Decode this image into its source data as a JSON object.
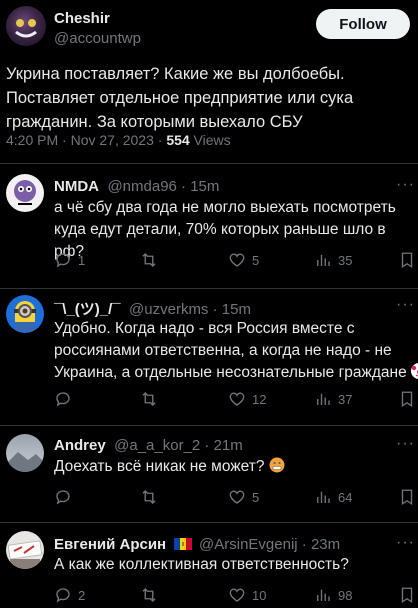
{
  "main_tweet": {
    "author_name": "Cheshir",
    "author_handle": "@accountwp",
    "follow_label": "Follow",
    "text_lines": [
      "Укрина поставляет? Какие же вы долбоебы.",
      "Поставляет отдельное предприятие или сука",
      "гражданин. За которыми выехало СБУ"
    ],
    "meta_time": "4:20 PM · Nov 27, 2023 · ",
    "views_count": "554",
    "views_label": " Views"
  },
  "replies": [
    {
      "name": "NMDA",
      "handle": "@nmda96 · 15m",
      "text_lines": [
        "а чё сбу два года не могло выехать посмотреть",
        "куда едут детали, 70% которых раньше шло в рф?"
      ],
      "reply_count": "1",
      "retweet_count": "",
      "like_count": "5",
      "view_count": "35"
    },
    {
      "name": "¯\\_(ツ)_/¯",
      "handle": "@uzverkms · 15m",
      "text_lines": [
        "Удобно. Когда надо - вся Россия вместе с",
        "россиянами ответственна, а когда не надо - не",
        "Украина, а отдельные несознательные граждане"
      ],
      "emoji": "clown-face-icon",
      "reply_count": "",
      "retweet_count": "",
      "like_count": "12",
      "view_count": "37"
    },
    {
      "name": "Andrey",
      "handle": "@a_a_kor_2 · 21m",
      "text_lines": [
        "Доехать всё никак не может?"
      ],
      "emoji": "grimacing-face-icon",
      "reply_count": "",
      "retweet_count": "",
      "like_count": "5",
      "view_count": "64"
    },
    {
      "name": "Евгений Арсин",
      "handle": "@ArsinEvgenij · 23m",
      "text_lines": [
        "А как же коллективная ответственность?"
      ],
      "flag": "moldova-flag-icon",
      "reply_count": "2",
      "retweet_count": "",
      "like_count": "10",
      "view_count": "98"
    }
  ],
  "more_label": "···"
}
